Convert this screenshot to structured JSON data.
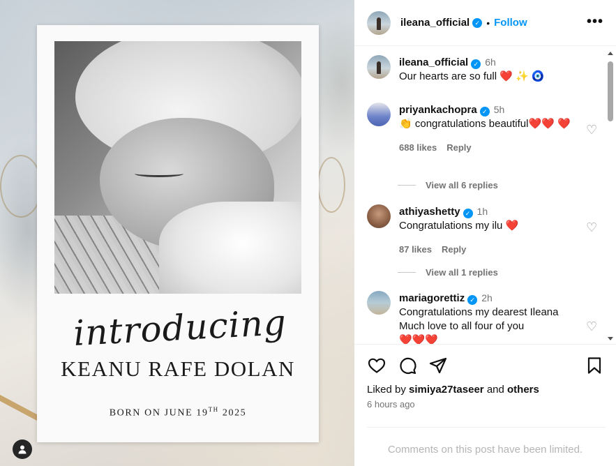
{
  "post_image": {
    "intro_text": "introducing",
    "baby_name": "KEANU RAFE DOLAN",
    "born_prefix": "BORN ON JUNE 19",
    "born_suffix": "TH",
    "born_year": "2025"
  },
  "header": {
    "username": "ileana_official",
    "separator": "•",
    "follow_label": "Follow",
    "more_icon": "more-horizontal-icon"
  },
  "comments": [
    {
      "username": "ileana_official",
      "verified": true,
      "time": "6h",
      "text": "Our hearts are so full",
      "emojis": "❤️ ✨ 🧿"
    },
    {
      "username": "priyankachopra",
      "verified": true,
      "time": "5h",
      "prefix_emoji": "👏",
      "text": "congratulations beautiful",
      "emojis": "❤️❤️ ❤️",
      "likes": "688 likes",
      "reply_label": "Reply",
      "view_replies": "View all 6 replies"
    },
    {
      "username": "athiyashetty",
      "verified": true,
      "time": "1h",
      "text": "Congratulations my ilu",
      "emojis": "❤️",
      "likes": "87 likes",
      "reply_label": "Reply",
      "view_replies": "View all 1 replies"
    },
    {
      "username": "mariagorettiz",
      "verified": true,
      "time": "2h",
      "text_line1": "Congratulations my dearest Ileana",
      "text_line2": "Much love to all four of you",
      "emojis": "❤️❤️❤️"
    }
  ],
  "footer": {
    "liked_by_prefix": "Liked by",
    "liked_by_user": "simiya27taseer",
    "liked_by_and": "and",
    "liked_by_others": "others",
    "time": "6 hours ago",
    "limited_notice": "Comments on this post have been limited."
  },
  "colors": {
    "accent": "#0095f6",
    "heart": "#e0243a",
    "muted": "#737373"
  }
}
